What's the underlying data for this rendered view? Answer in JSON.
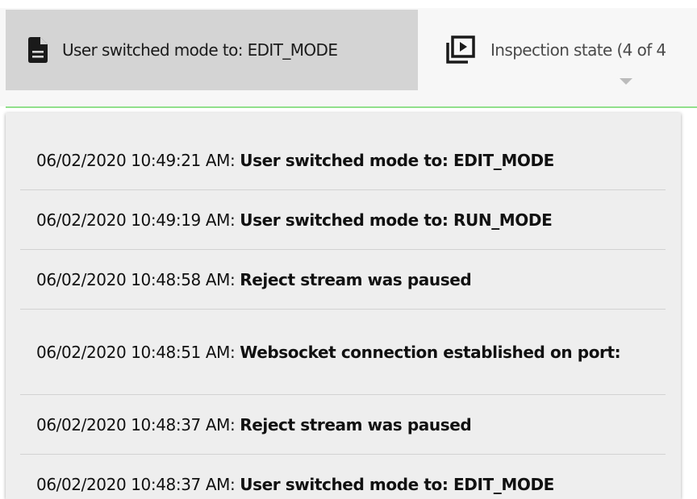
{
  "header": {
    "active_tab": {
      "label": "User switched mode to: EDIT_MODE",
      "icon": "document-icon"
    },
    "inspection_tab": {
      "label": "Inspection state (4 of 4",
      "icon": "play-stack-icon"
    }
  },
  "colors": {
    "accent_line": "#91e08c",
    "active_tab_bg": "#d4d4d4",
    "panel_bg": "#eeeeee"
  },
  "log": {
    "items": [
      {
        "timestamp": "06/02/2020 10:49:21 AM:",
        "message": "User switched mode to: EDIT_MODE"
      },
      {
        "timestamp": "06/02/2020 10:49:19 AM:",
        "message": "User switched mode to: RUN_MODE"
      },
      {
        "timestamp": "06/02/2020 10:48:58 AM:",
        "message": "Reject stream was paused"
      },
      {
        "timestamp": "06/02/2020 10:48:51 AM:",
        "message": "Websocket connection established on port:"
      },
      {
        "timestamp": "06/02/2020 10:48:37 AM:",
        "message": "Reject stream was paused"
      },
      {
        "timestamp": "06/02/2020 10:48:37 AM:",
        "message": "User switched mode to: EDIT_MODE"
      }
    ]
  }
}
